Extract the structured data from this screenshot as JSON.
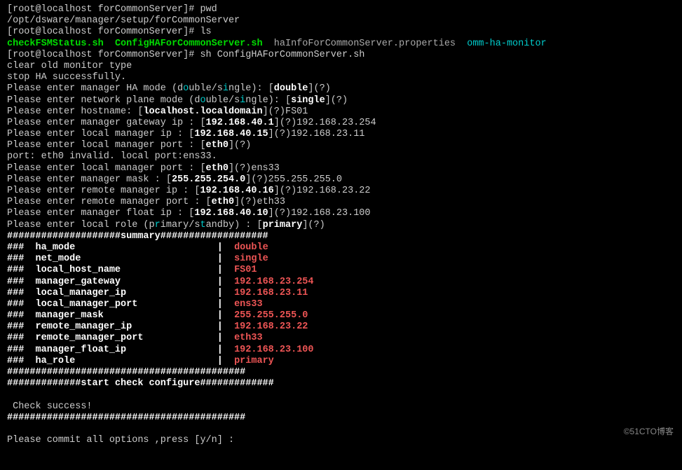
{
  "prompt_user_host": "root@localhost",
  "prompt_cwd": "forCommonServer",
  "prompt_open": "[",
  "prompt_close": "]#",
  "cmd_pwd": "pwd",
  "pwd_output": "/opt/dsware/manager/setup/forCommonServer",
  "cmd_ls": "ls",
  "ls_file1": "checkFSMStatus.sh",
  "ls_file2": "ConfigHAForCommonServer.sh",
  "ls_file3": "haInfoForCommonServer.properties",
  "ls_file4": "omm-ha-monitor",
  "cmd_sh": "sh ConfigHAForCommonServer.sh",
  "msg_clear": "clear old monitor type",
  "msg_stop": "stop HA successfully.",
  "p_ha_mode_a": "Please enter manager HA mode (d",
  "p_ha_mode_b": "o",
  "p_ha_mode_c": "uble/s",
  "p_ha_mode_d": "i",
  "p_ha_mode_e": "ngle): [",
  "p_ha_mode_def": "double",
  "p_ha_mode_f": "](?)",
  "p_net_mode_a": "Please enter network plane mode (d",
  "p_net_mode_b": "o",
  "p_net_mode_c": "uble/s",
  "p_net_mode_d": "i",
  "p_net_mode_e": "ngle): [",
  "p_net_mode_def": "single",
  "p_net_mode_f": "](?)",
  "p_hostname_a": "Please enter hostname: [",
  "p_hostname_def": "localhost.localdomain",
  "p_hostname_b": "](?)FS01",
  "p_gw_a": "Please enter manager gateway ip : [",
  "p_gw_def": "192.168.40.1",
  "p_gw_b": "](?)192.168.23.254",
  "p_lip_a": "Please enter local manager ip : [",
  "p_lip_def": "192.168.40.15",
  "p_lip_b": "](?)192.168.23.11",
  "p_lport_a": "Please enter local manager port : [",
  "p_lport_def": "eth0",
  "p_lport_b": "](?)",
  "msg_port_invalid": "port: eth0 invalid. local port:ens33.",
  "p_lport2_a": "Please enter local manager port : [",
  "p_lport2_def": "eth0",
  "p_lport2_b": "](?)ens33",
  "p_mask_a": "Please enter manager mask : [",
  "p_mask_def": "255.255.254.0",
  "p_mask_b": "](?)255.255.255.0",
  "p_rip_a": "Please enter remote manager ip : [",
  "p_rip_def": "192.168.40.16",
  "p_rip_b": "](?)192.168.23.22",
  "p_rport_a": "Please enter remote manager port : [",
  "p_rport_def": "eth0",
  "p_rport_b": "](?)eth33",
  "p_fip_a": "Please enter manager float ip : [",
  "p_fip_def": "192.168.40.10",
  "p_fip_b": "](?)192.168.23.100",
  "p_role_a": "Please enter local role (p",
  "p_role_b": "r",
  "p_role_c": "imary/s",
  "p_role_d": "t",
  "p_role_e": "andby) : [",
  "p_role_def": "primary",
  "p_role_f": "](?)",
  "summary_header": "####################summary###################",
  "summary": [
    {
      "key": "ha_mode",
      "val": "double"
    },
    {
      "key": "net_mode",
      "val": "single"
    },
    {
      "key": "local_host_name",
      "val": "FS01"
    },
    {
      "key": "manager_gateway",
      "val": "192.168.23.254"
    },
    {
      "key": "local_manager_ip",
      "val": "192.168.23.11"
    },
    {
      "key": "local_manager_port",
      "val": "ens33"
    },
    {
      "key": "manager_mask",
      "val": "255.255.255.0"
    },
    {
      "key": "remote_manager_ip",
      "val": "192.168.23.22"
    },
    {
      "key": "remote_manager_port",
      "val": "eth33"
    },
    {
      "key": "manager_float_ip",
      "val": "192.168.23.100"
    },
    {
      "key": "ha_role",
      "val": "primary"
    }
  ],
  "hash_prefix": "###  ",
  "hash_sep": "|  ",
  "hash_line": "##########################################",
  "start_check": "#############start check configure#############",
  "check_success": " Check success!",
  "hash_line2": "##########################################",
  "commit_prompt": "Please commit all options ,press [y/n] :",
  "watermark": "©51CTO博客"
}
